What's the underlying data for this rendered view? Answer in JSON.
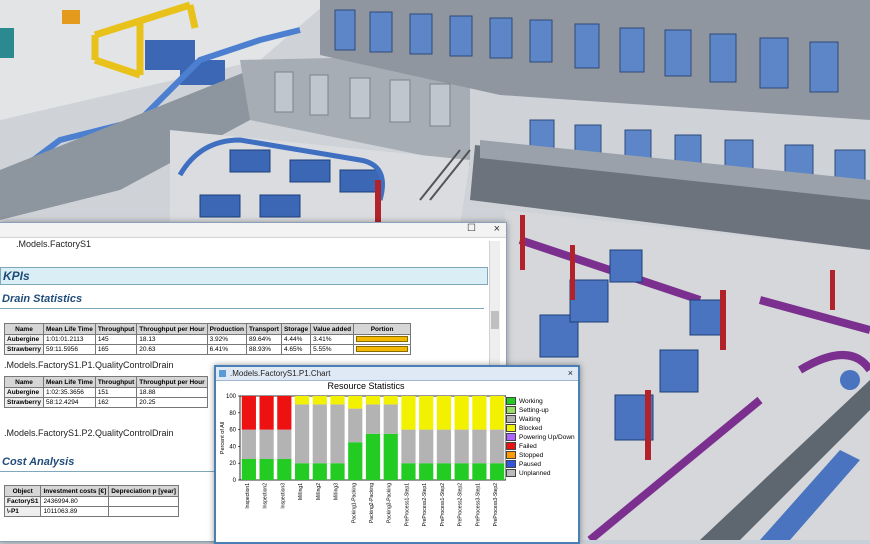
{
  "colors": {
    "sky": "#c9cfd6",
    "wall": "#9aa1aa",
    "floor": "#d8d9db",
    "machine_blue": "#3b67b5",
    "conveyor_purple": "#7b2f8f",
    "pillar_red": "#b2222a",
    "conveyor_yellow": "#e8c21a",
    "accent": "#4a7fb5"
  },
  "report": {
    "path_top": ".Models.FactoryS1",
    "kpis_title": "KPIs",
    "drain_title": "Drain Statistics",
    "drain_table": {
      "headers": [
        "Name",
        "Mean Life Time",
        "Throughput",
        "Throughput per Hour",
        "Production",
        "Transport",
        "Storage",
        "Value added",
        "Portion"
      ],
      "rows": [
        [
          "Aubergine",
          "1:01:01.2113",
          "145",
          "18.13",
          "3.92%",
          "89.64%",
          "4.44%",
          "3.41%",
          ""
        ],
        [
          "Strawberry",
          "59:11.5956",
          "165",
          "20.63",
          "6.41%",
          "88.93%",
          "4.65%",
          "5.55%",
          ""
        ]
      ]
    },
    "path_p1": ".Models.FactoryS1.P1.QualityControlDrain",
    "drain_table_2": {
      "headers": [
        "Name",
        "Mean Life Time",
        "Throughput",
        "Throughput per Hour"
      ],
      "rows": [
        [
          "Aubergine",
          "1:02:35.3656",
          "151",
          "18.88"
        ],
        [
          "Strawberry",
          "58:12.4294",
          "162",
          "20.25"
        ]
      ]
    },
    "path_p2": ".Models.FactoryS1.P2.QualityControlDrain",
    "cost_title": "Cost Analysis",
    "cost_table": {
      "headers": [
        "Object",
        "Investment costs [€]",
        "Depreciation p [year]"
      ],
      "rows": [
        [
          "FactoryS1",
          "2436994.80",
          ""
        ],
        [
          "\\-P1",
          "1011063.89",
          ""
        ]
      ]
    }
  },
  "chart_window": {
    "title": ".Models.FactoryS1.P1.Chart",
    "close_glyph": "×"
  },
  "chart_data": {
    "type": "bar",
    "stacked": true,
    "title": "Resource Statistics",
    "ylabel": "Percent of All",
    "ylim": [
      0,
      100
    ],
    "yticks": [
      0,
      20,
      40,
      60,
      80,
      100
    ],
    "categories": [
      "Inspection1",
      "Inspection2",
      "Inspection3",
      "Milling1",
      "Milling2",
      "Milling3",
      "Packing1-Packing",
      "Packing2-Packing",
      "Packing3-Packing",
      "PreProcess1-Step1",
      "PreProcess2-Step1",
      "PreProcess1-Step2",
      "PreProcess2-Step2",
      "PreProcess3-Step1",
      "PreProcess3-Step2"
    ],
    "series": [
      {
        "name": "Working",
        "color": "#22cc22",
        "values": [
          25,
          25,
          25,
          20,
          20,
          20,
          45,
          55,
          55,
          20,
          20,
          20,
          20,
          20,
          20
        ]
      },
      {
        "name": "Setting-up",
        "color": "#99dd66",
        "values": [
          0,
          0,
          0,
          0,
          0,
          0,
          0,
          0,
          0,
          0,
          0,
          0,
          0,
          0,
          0
        ]
      },
      {
        "name": "Waiting",
        "color": "#b3b3b3",
        "values": [
          35,
          35,
          35,
          70,
          70,
          70,
          40,
          35,
          35,
          40,
          40,
          40,
          40,
          40,
          40
        ]
      },
      {
        "name": "Blocked",
        "color": "#f2f200",
        "values": [
          0,
          0,
          0,
          10,
          10,
          10,
          15,
          10,
          10,
          40,
          40,
          40,
          40,
          40,
          40
        ]
      },
      {
        "name": "Powering Up/Down",
        "color": "#aa66ff",
        "values": [
          0,
          0,
          0,
          0,
          0,
          0,
          0,
          0,
          0,
          0,
          0,
          0,
          0,
          0,
          0
        ]
      },
      {
        "name": "Failed",
        "color": "#ee1111",
        "values": [
          40,
          40,
          40,
          0,
          0,
          0,
          0,
          0,
          0,
          0,
          0,
          0,
          0,
          0,
          0
        ]
      },
      {
        "name": "Stopped",
        "color": "#ff9900",
        "values": [
          0,
          0,
          0,
          0,
          0,
          0,
          0,
          0,
          0,
          0,
          0,
          0,
          0,
          0,
          0
        ]
      },
      {
        "name": "Paused",
        "color": "#3355dd",
        "values": [
          0,
          0,
          0,
          0,
          0,
          0,
          0,
          0,
          0,
          0,
          0,
          0,
          0,
          0,
          0
        ]
      },
      {
        "name": "Unplanned",
        "color": "#bbbbbb",
        "values": [
          0,
          0,
          0,
          0,
          0,
          0,
          0,
          0,
          0,
          0,
          0,
          0,
          0,
          0,
          0
        ]
      }
    ],
    "legend": "right"
  }
}
